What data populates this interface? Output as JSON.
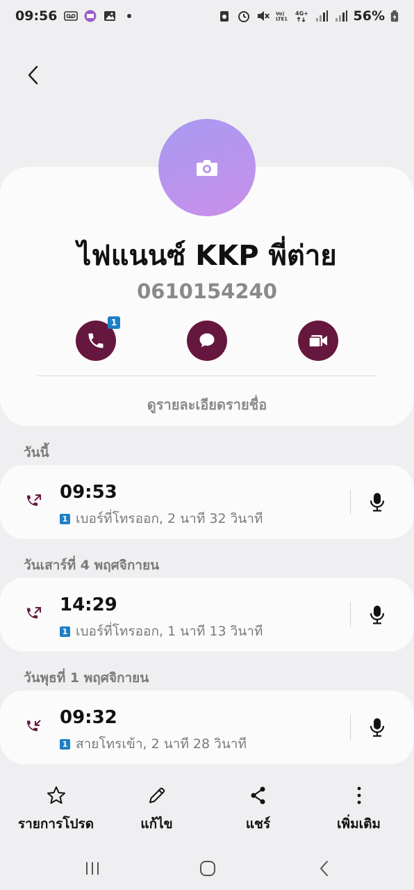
{
  "status_bar": {
    "time": "09:56",
    "battery": "56%",
    "icons_left": [
      "voicemail-icon",
      "app-badge-icon",
      "gallery-icon",
      "dot-icon"
    ],
    "icons_right": [
      "recycle-icon",
      "alarm-icon",
      "mute-icon",
      "volte-icon",
      "4g-icon",
      "signal-icon",
      "signal-icon",
      "battery-icon"
    ]
  },
  "contact": {
    "name": "ไฟแนนซ์ KKP พี่ต่าย",
    "number": "0610154240",
    "call_badge": "1",
    "view_details": "ดูรายละเอียดรายชื่อ"
  },
  "call_log": [
    {
      "header": "วันนี้",
      "time": "09:53",
      "sim": "1",
      "detail": "เบอร์ที่โทรออก, 2 นาที 32 วินาที",
      "direction": "outgoing"
    },
    {
      "header": "วันเสาร์ที่ 4 พฤศจิกายน",
      "time": "14:29",
      "sim": "1",
      "detail": "เบอร์ที่โทรออก, 1 นาที 13 วินาที",
      "direction": "outgoing"
    },
    {
      "header": "วันพุธที่ 1 พฤศจิกายน",
      "time": "09:32",
      "sim": "1",
      "detail": "สายโทรเข้า, 2 นาที 28 วินาที",
      "direction": "incoming"
    }
  ],
  "bottom_bar": {
    "favorites": "รายการโปรด",
    "edit": "แก้ไข",
    "share": "แชร์",
    "more": "เพิ่มเติม"
  },
  "colors": {
    "accent": "#66173d",
    "badge": "#1f7fc4",
    "background": "#efeff1",
    "card": "#fbfbfc"
  }
}
